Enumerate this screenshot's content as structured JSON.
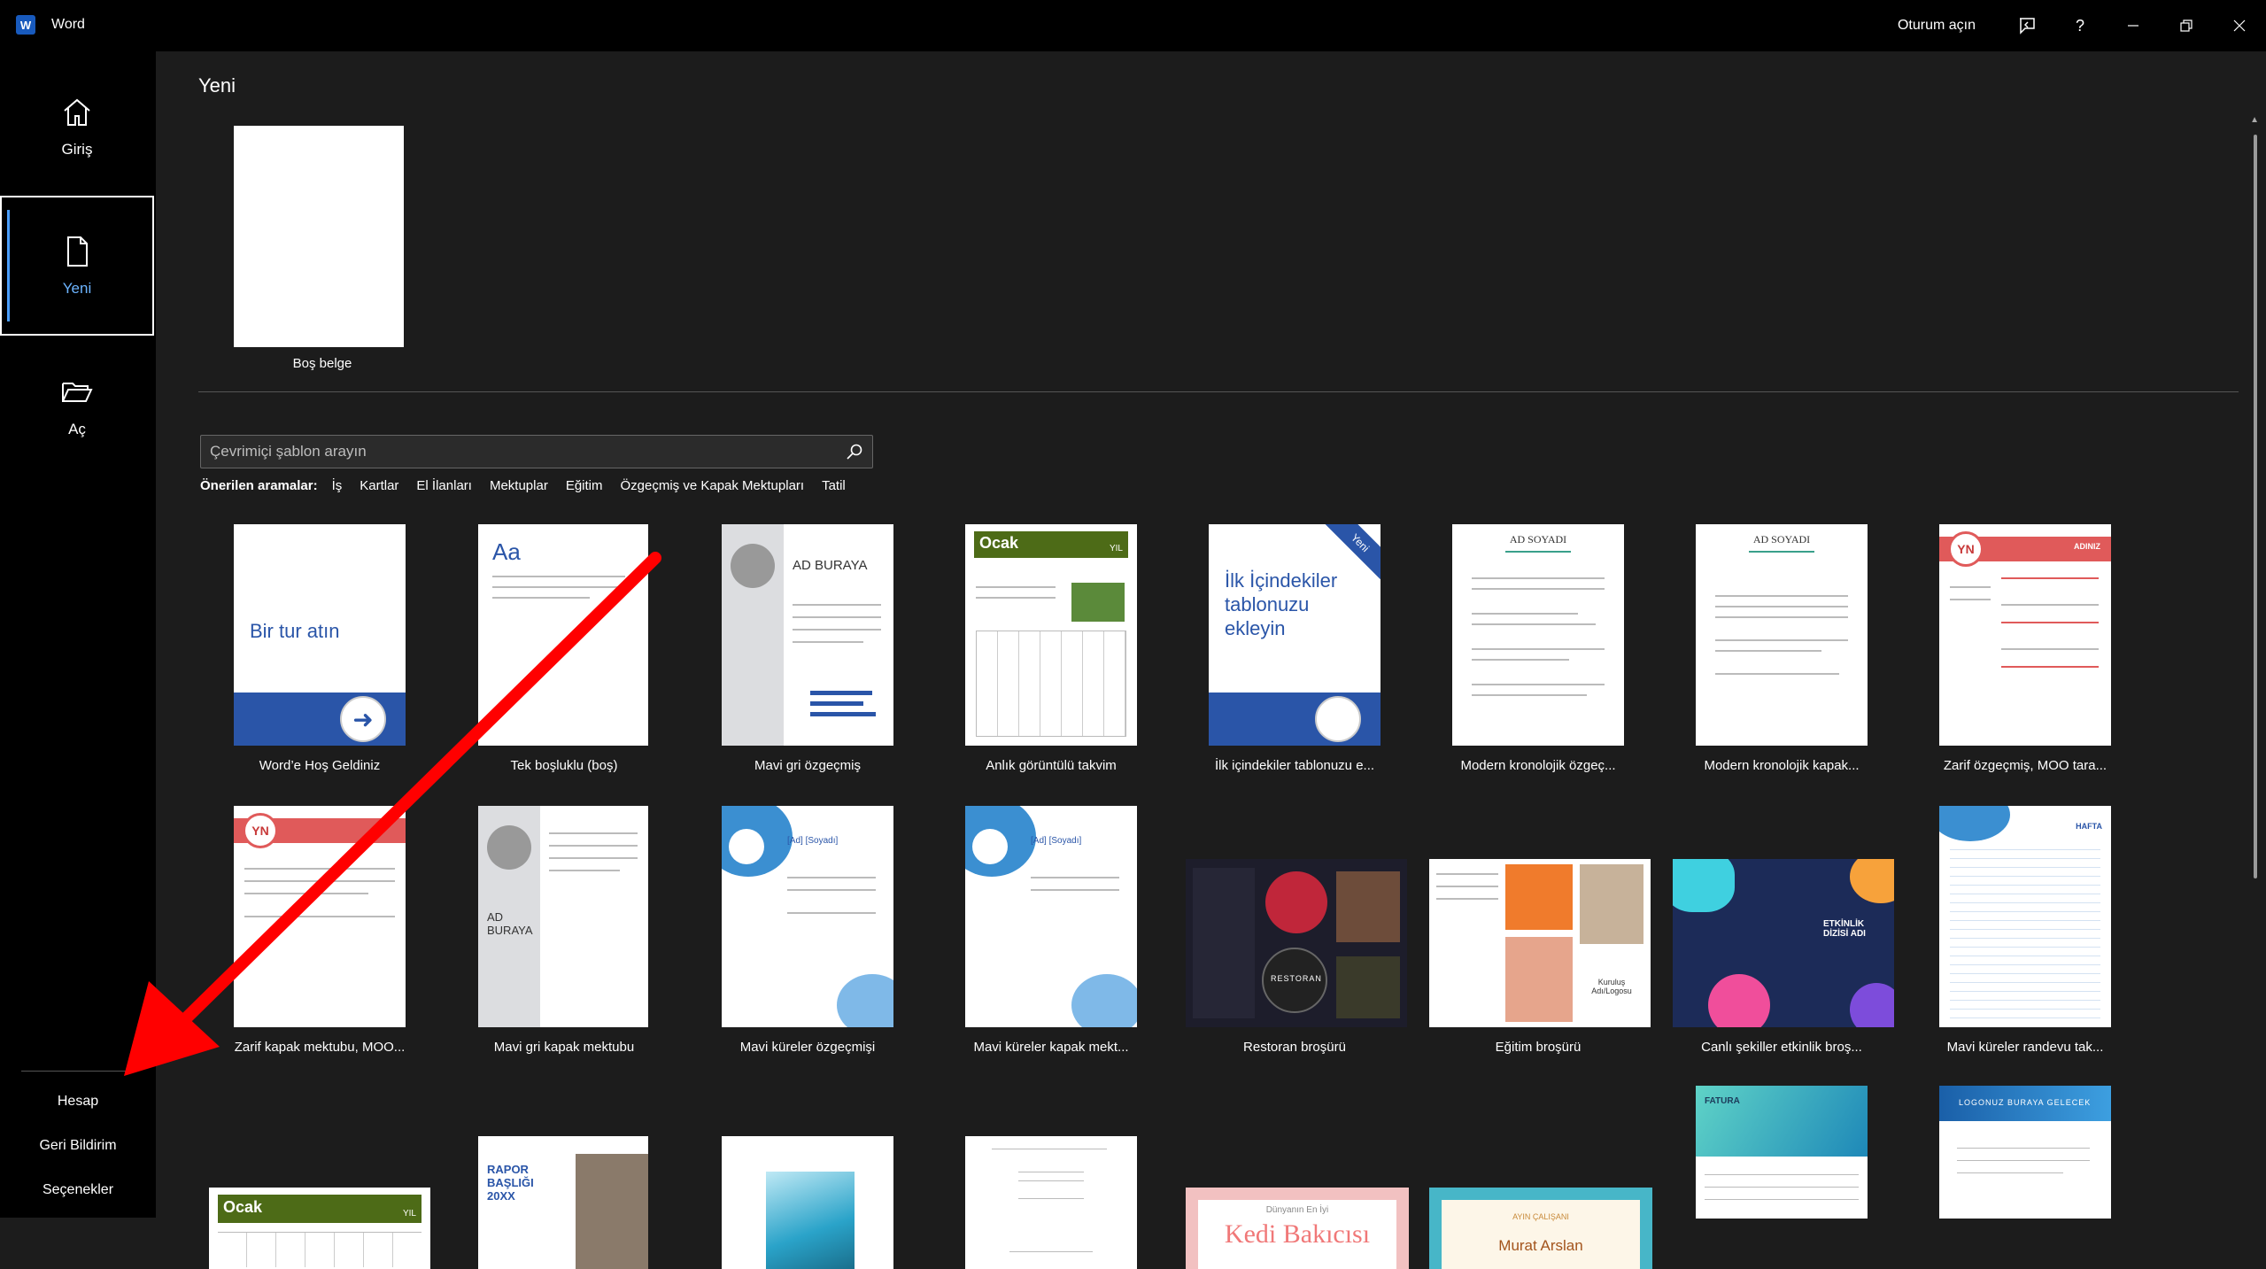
{
  "window": {
    "app_name": "Word",
    "sign_in": "Oturum açın"
  },
  "rail": {
    "home": "Giriş",
    "new": "Yeni",
    "open": "Aç",
    "account": "Hesap",
    "feedback": "Geri Bildirim",
    "options": "Seçenekler"
  },
  "main": {
    "title": "Yeni",
    "blank_label": "Boş belge",
    "search_placeholder": "Çevrimiçi şablon arayın",
    "suggested_label": "Önerilen aramalar:",
    "suggested": [
      "İş",
      "Kartlar",
      "El İlanları",
      "Mektuplar",
      "Eğitim",
      "Özgeçmiş ve Kapak Mektupları",
      "Tatil"
    ]
  },
  "templates_row1": [
    {
      "label": "Word’e Hoş Geldiniz",
      "thumb_text": "Bir tur atın"
    },
    {
      "label": "Tek boşluklu (boş)",
      "thumb_text": "Aa"
    },
    {
      "label": "Mavi gri özgeçmiş",
      "thumb_text": "AD BURAYA"
    },
    {
      "label": "Anlık görüntülü takvim",
      "thumb_text": "Ocak",
      "thumb_sub": "YIL"
    },
    {
      "label": "İlk içindekiler tablonuzu e...",
      "thumb_text": "İlk İçindekiler tablonuzu ekleyin",
      "badge": "Yeni"
    },
    {
      "label": "Modern kronolojik özgeç...",
      "thumb_text": "AD SOYADI"
    },
    {
      "label": "Modern kronolojik kapak...",
      "thumb_text": "AD SOYADI"
    },
    {
      "label": "Zarif özgeçmiş, MOO tara...",
      "thumb_text": "YN",
      "thumb_sub": "ADINIZ"
    }
  ],
  "templates_row2": [
    {
      "label": "Zarif kapak mektubu, MOO...",
      "thumb_text": "YN"
    },
    {
      "label": "Mavi gri kapak mektubu",
      "thumb_text": "AD BURAYA"
    },
    {
      "label": "Mavi küreler özgeçmişi",
      "thumb_text": "[Ad] [Soyadı]"
    },
    {
      "label": "Mavi küreler kapak mekt...",
      "thumb_text": "[Ad] [Soyadı]"
    },
    {
      "label": "Restoran broşürü",
      "thumb_text": "RESTORAN"
    },
    {
      "label": "Eğitim broşürü",
      "thumb_text": "Kuruluş Adı/Logosu"
    },
    {
      "label": "Canlı şekiller etkinlik broş...",
      "thumb_text": "ETKİNLİK DİZİSİ ADI"
    },
    {
      "label": "Mavi küreler randevu tak...",
      "thumb_text": "HAFTA"
    }
  ],
  "templates_row3": [
    {
      "thumb_text": "Ocak",
      "thumb_sub": "YIL"
    },
    {
      "thumb_text": "RAPOR BAŞLIĞI 20XX"
    },
    {
      "thumb_text": ""
    },
    {
      "thumb_text": ""
    },
    {
      "thumb_text": "Kedi Bakıcısı",
      "thumb_sub": "Dünyanın En İyi"
    },
    {
      "thumb_text": "Murat Arslan",
      "thumb_sub": "AYIN ÇALIŞANI"
    },
    {
      "thumb_text": "FATURA"
    },
    {
      "thumb_text": "LOGONUZ BURAYA GELECEK"
    }
  ],
  "colors": {
    "accent": "#4a9eff",
    "word_blue": "#185abd",
    "annotation_red": "#ff0000"
  }
}
